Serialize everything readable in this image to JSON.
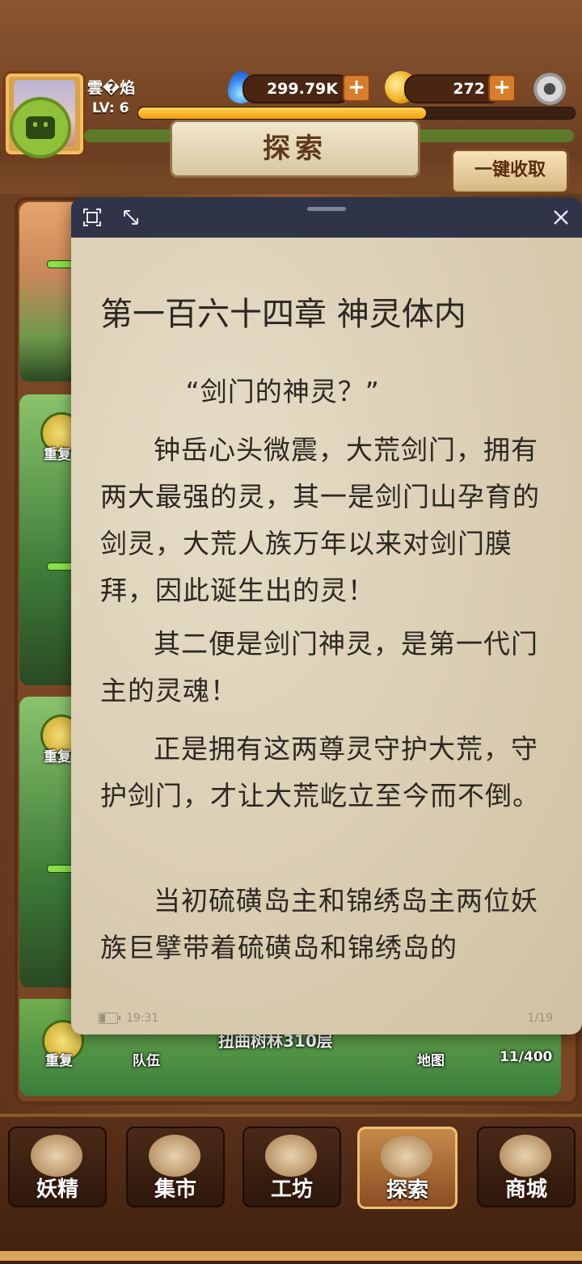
{
  "player": {
    "name": "雲�焰",
    "level": "LV: 6",
    "xp_fraction": 0.66
  },
  "resources": {
    "spirit": "299.79K",
    "coins": "272"
  },
  "header": {
    "title": "探索",
    "collect_all": "一键收取"
  },
  "background_cards": {
    "repeat_label": "重复",
    "team_label": "队伍",
    "map_label": "地图",
    "capacity": "11/400",
    "stage_title": "扭曲树林310层"
  },
  "nav": {
    "items": [
      {
        "label": "妖精"
      },
      {
        "label": "集市"
      },
      {
        "label": "工坊"
      },
      {
        "label": "探索"
      },
      {
        "label": "商城"
      }
    ],
    "active_index": 3
  },
  "reader": {
    "chapter_title": "第一百六十四章 神灵体内",
    "paragraphs": [
      "“剑门的神灵？”",
      "钟岳心头微震，大荒剑门，拥有两大最强的灵，其一是剑门山孕育的剑灵，大荒人族万年以来对剑门膜拜，因此诞生出的灵！",
      "其二便是剑门神灵，是第一代门主的灵魂！",
      "正是拥有这两尊灵守护大荒，守护剑门，才让大荒屹立至今而不倒。",
      "当初硫磺岛主和锦绣岛主两位妖族巨擘带着硫磺岛和锦绣岛的"
    ],
    "time": "19:31",
    "page": "1/19"
  },
  "colors": {
    "reader_header": "#2f3448",
    "paper": "#dcd0b6",
    "text": "#2c2721",
    "xp": "#f59d0a"
  }
}
